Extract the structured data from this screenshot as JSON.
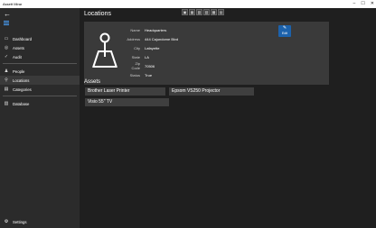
{
  "window": {
    "title": "Assett Mirar"
  },
  "sidebar": {
    "items": [
      {
        "label": "Dashboard",
        "icon": "dashboard-icon",
        "glyph": "▭"
      },
      {
        "label": "Assets",
        "icon": "assets-icon",
        "glyph": "◎"
      },
      {
        "label": "Audit",
        "icon": "audit-icon",
        "glyph": "✓"
      },
      {
        "label": "People",
        "icon": "people-icon",
        "glyph": "♟"
      },
      {
        "label": "Locations",
        "icon": "locations-icon",
        "glyph": "⚲"
      },
      {
        "label": "Categories",
        "icon": "categories-icon",
        "glyph": "▤"
      },
      {
        "label": "Database",
        "icon": "database-icon",
        "glyph": "▥"
      }
    ],
    "settings_label": "Settings"
  },
  "toolbar": {
    "buttons": [
      "▣",
      "▦",
      "▧",
      "▨",
      "▩",
      "▤"
    ]
  },
  "page": {
    "title": "Locations"
  },
  "location": {
    "fields": [
      {
        "label": "Name",
        "value": "Headquarters"
      },
      {
        "label": "Address",
        "value": "444 Cajundome Blvd"
      },
      {
        "label": "City",
        "value": "Lafayette"
      },
      {
        "label": "State",
        "value": "LA"
      },
      {
        "label": "Zip Code",
        "value": "70506"
      },
      {
        "label": "Status",
        "value": "True"
      }
    ],
    "edit_label": "Edit"
  },
  "assets": {
    "title": "Assets",
    "items": [
      "Brother Laser Printer",
      "Epsom VS250 Projector",
      "Visio 55\" TV"
    ]
  },
  "colors": {
    "accent": "#4aa3ff",
    "edit_button": "#1c62ac"
  }
}
